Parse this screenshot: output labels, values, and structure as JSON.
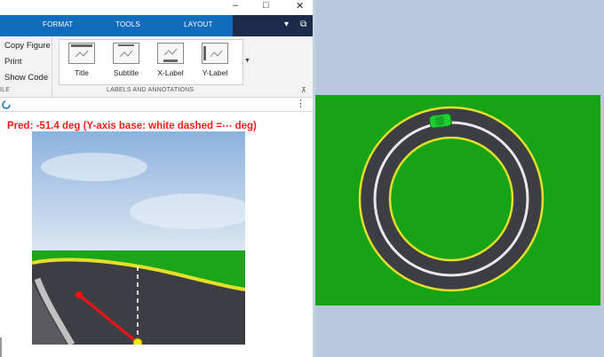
{
  "window": {
    "minimize_glyph": "–",
    "maximize_glyph": "□",
    "close_glyph": "✕"
  },
  "ribbon_tabs": [
    {
      "label": "FORMAT"
    },
    {
      "label": "TOOLS"
    },
    {
      "label": "LAYOUT"
    }
  ],
  "ribbon": {
    "left_items": [
      {
        "label": "Copy Figure"
      },
      {
        "label": "Print"
      },
      {
        "label": "Show Code"
      }
    ],
    "left_group_label_partial": "ILE",
    "gallery_items": [
      {
        "label": "Title"
      },
      {
        "label": "Subtitle"
      },
      {
        "label": "X-Label"
      },
      {
        "label": "Y-Label"
      }
    ],
    "group_label": "LABELS AND ANNOTATIONS"
  },
  "subbar": {
    "more_glyph": "⋮"
  },
  "prediction_text": "Pred: -51.4 deg  (Y-axis base: white dashed =⋯ deg)",
  "colors": {
    "accent_blue": "#0f6cbd",
    "pred_red": "#ff1a1a",
    "track_green": "#16a316",
    "car_green": "#22cc33",
    "road_gray": "#4b4b4f",
    "lane_yellow": "#e8e02a"
  }
}
